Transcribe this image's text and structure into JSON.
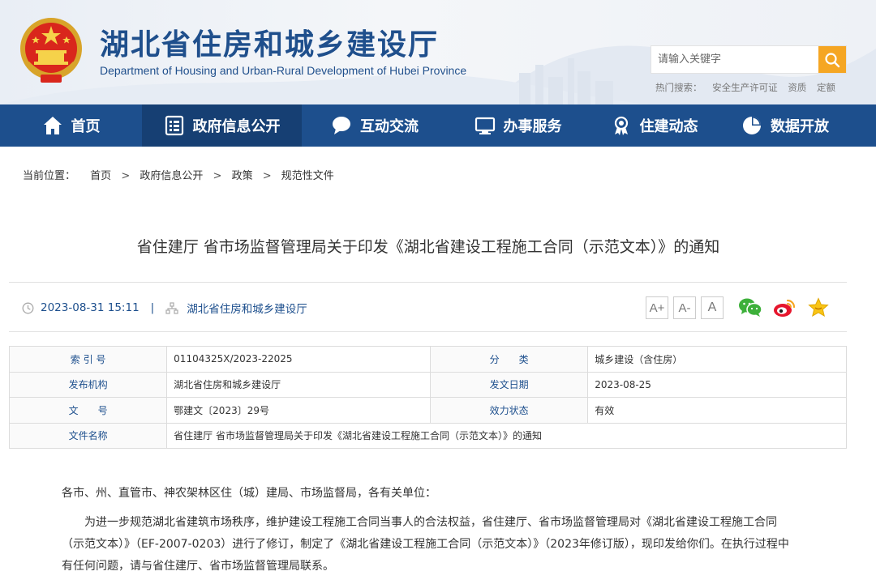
{
  "header": {
    "title": "湖北省住房和城乡建设厅",
    "subtitle": "Department of Housing and Urban-Rural Development of Hubei Province",
    "search_placeholder": "请输入关键字",
    "hot_label": "热门搜索：",
    "hot_words": [
      "安全生产许可证",
      "资质",
      "定额"
    ],
    "colors": {
      "primary": "#1d4f8d",
      "search_button": "#f5a623"
    }
  },
  "nav": [
    {
      "label": "首页",
      "icon": "home-icon"
    },
    {
      "label": "政府信息公开",
      "icon": "document-list-icon",
      "active": true
    },
    {
      "label": "互动交流",
      "icon": "chat-bubble-icon"
    },
    {
      "label": "办事服务",
      "icon": "monitor-icon"
    },
    {
      "label": "住建动态",
      "icon": "award-icon"
    },
    {
      "label": "数据开放",
      "icon": "pie-chart-icon"
    }
  ],
  "breadcrumb": {
    "label": "当前位置：",
    "items": [
      "首页",
      "政府信息公开",
      "政策",
      "规范性文件"
    ],
    "separator": ">"
  },
  "article": {
    "title": "省住建厅 省市场监督管理局关于印发《湖北省建设工程施工合同（示范文本）》的通知",
    "datetime": "2023-08-31 15:11",
    "divider": "|",
    "source": "湖北省住房和城乡建设厅",
    "font_sizes": [
      "A+",
      "A-",
      "A"
    ]
  },
  "info": {
    "index_label": "索 引 号",
    "index_value": "01104325X/2023-22025",
    "category_label": "分　　类",
    "category_value": "城乡建设（含住房）",
    "issuer_label": "发布机构",
    "issuer_value": "湖北省住房和城乡建设厅",
    "date_label": "发文日期",
    "date_value": "2023-08-25",
    "doc_no_label": "文　　号",
    "doc_no_value": "鄂建文〔2023〕29号",
    "status_label": "效力状态",
    "status_value": "有效",
    "name_label": "文件名称",
    "name_value": "省住建厅 省市场监督管理局关于印发《湖北省建设工程施工合同（示范文本）》的通知"
  },
  "content": {
    "salutation": "各市、州、直管市、神农架林区住（城）建局、市场监督局，各有关单位：",
    "paragraph1": "为进一步规范湖北省建筑市场秩序，维护建设工程施工合同当事人的合法权益，省住建厅、省市场监督管理局对《湖北省建设工程施工合同（示范文本）》（EF-2007-0203）进行了修订，制定了《湖北省建设工程施工合同（示范文本）》（2023年修订版），现印发给你们。在执行过程中有任何问题，请与省住建厅、省市场监督管理局联系。"
  }
}
